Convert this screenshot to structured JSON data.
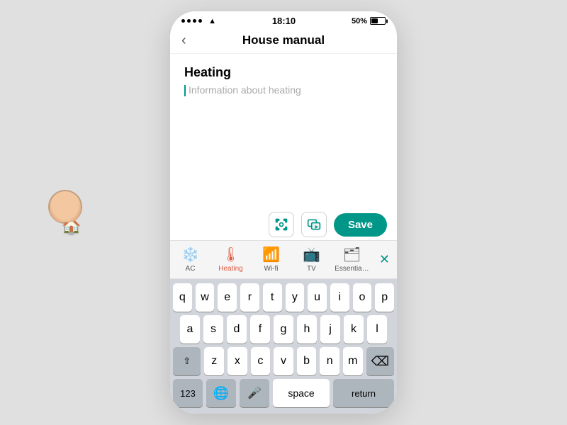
{
  "statusBar": {
    "time": "18:10",
    "battery": "50%",
    "dots": [
      "•",
      "•",
      "•",
      "•"
    ]
  },
  "nav": {
    "backLabel": "‹",
    "title": "House manual"
  },
  "content": {
    "sectionTitle": "Heating",
    "placeholder": "Information about heating"
  },
  "toolbar": {
    "saveLabel": "Save"
  },
  "categories": [
    {
      "id": "ac",
      "label": "AC",
      "icon": "❄",
      "active": false
    },
    {
      "id": "heating",
      "label": "Heating",
      "icon": "🌡",
      "active": true
    },
    {
      "id": "wifi",
      "label": "Wi-fi",
      "icon": "📶",
      "active": false
    },
    {
      "id": "tv",
      "label": "TV",
      "icon": "📺",
      "active": false
    },
    {
      "id": "essentials",
      "label": "Essentia…",
      "icon": "🗂",
      "active": false
    }
  ],
  "keyboard": {
    "rows": [
      [
        "q",
        "w",
        "e",
        "r",
        "t",
        "y",
        "u",
        "i",
        "o",
        "p"
      ],
      [
        "a",
        "s",
        "d",
        "f",
        "g",
        "h",
        "j",
        "k",
        "l"
      ],
      [
        "z",
        "x",
        "c",
        "v",
        "b",
        "n",
        "m"
      ]
    ],
    "bottomRow": {
      "num": "123",
      "globe": "🌐",
      "mic": "🎤",
      "space": "space",
      "return": "return"
    }
  },
  "colors": {
    "teal": "#009688",
    "red": "#e05a40",
    "keyBg": "#d1d5db"
  }
}
